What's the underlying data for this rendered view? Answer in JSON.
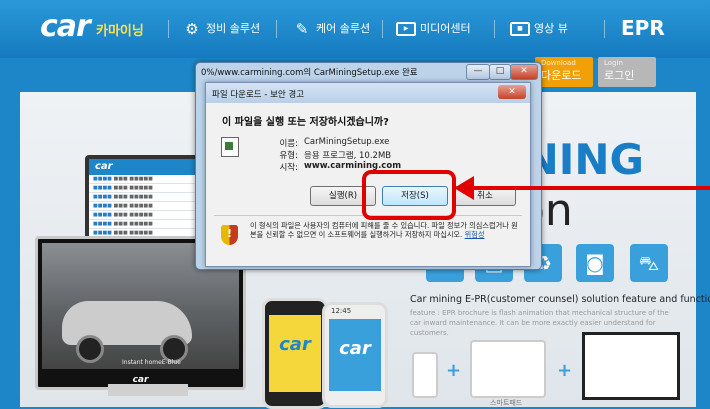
{
  "site": {
    "logo": "car",
    "logo_sub": "카마이닝",
    "nav": [
      {
        "label": "정비 솔루션",
        "icon": "gears-icon"
      },
      {
        "label": "케어 솔루션",
        "icon": "note-icon"
      },
      {
        "label": "미디어센터",
        "icon": "media-icon"
      },
      {
        "label": "영상 뷰",
        "icon": "video-icon"
      }
    ],
    "epr": "EPR",
    "download_tab": {
      "small": "Download",
      "label": "다운로드"
    },
    "login_tab": {
      "small": "Login",
      "label": "로그인"
    },
    "hero_line1": "INING",
    "hero_line2": "on",
    "feature_title": "Car mining E-PR(customer counsel) solution feature and function",
    "feature_desc": "feature : EPR brochure is flash animation that mechanical structure of the car inward maintenance. It can be more exactly easier understand for customers.",
    "monitor_label": "car",
    "monitor_caption": "Instant homeE-Blue",
    "tablet_logo": "car",
    "phone_time": "12:45",
    "phone1_logo": "car",
    "phone2_logo": "car",
    "mini_label": "스마트패드"
  },
  "window": {
    "title": "0%/www.carmining.com의 CarMiningSetup.exe 완료",
    "controls": {
      "minimize": "—",
      "maximize": "□",
      "close": "✕"
    }
  },
  "dialog": {
    "title": "파일 다운로드 - 보안 경고",
    "question": "이 파일을 실행 또는 저장하시겠습니까?",
    "name_label": "이름:",
    "name_value": "CarMiningSetup.exe",
    "type_label": "유형:",
    "type_value": "응용 프로그램, 10.2MB",
    "from_label": "시작:",
    "from_value": "www.carmining.com",
    "run_button": "실행(R)",
    "save_button": "저장(S)",
    "cancel_button": "취소",
    "close_button": "✕",
    "warning_text": "이 형식의 파일은 사용자의 컴퓨터에 피해를 줄 수 있습니다. 파일 정보가 의심스럽거나 원본을 신뢰할 수 없으면 이 소프트웨어를 실행하거나 저장하지 마십시오.",
    "warning_link": "위험성"
  },
  "colors": {
    "highlight": "#e00000",
    "brand_blue": "#1d86c8",
    "brand_yellow": "#f5d63b"
  }
}
